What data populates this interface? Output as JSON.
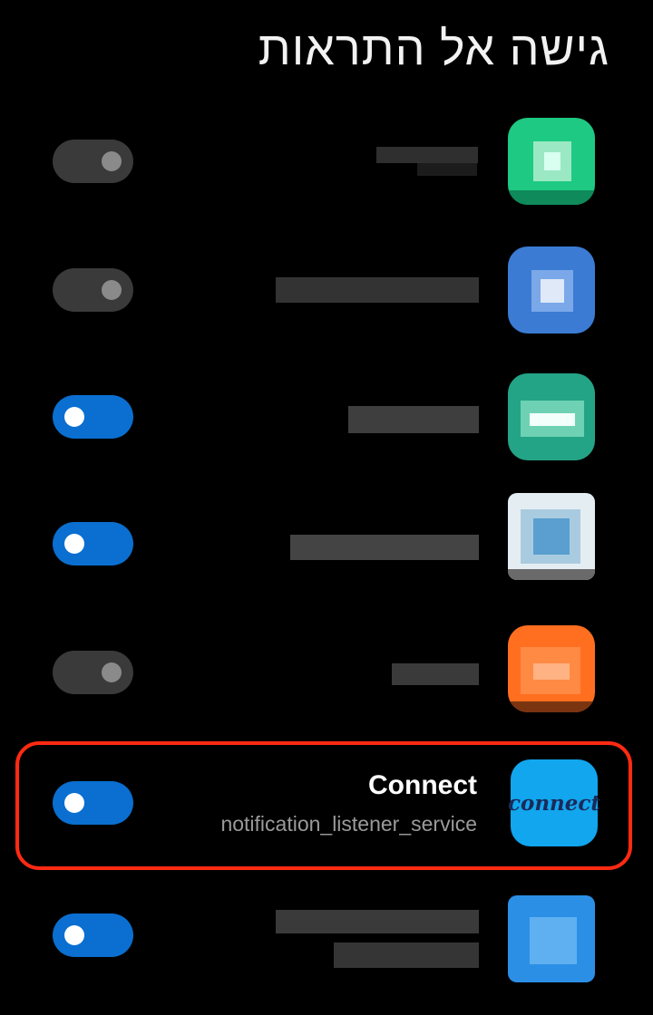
{
  "header": {
    "title": "גישה אל התראות"
  },
  "apps": [
    {
      "name": "",
      "enabled": false,
      "icon_color": "#1ec983"
    },
    {
      "name": "",
      "enabled": false,
      "icon_color": "#3b7bd4"
    },
    {
      "name": "",
      "enabled": true,
      "icon_color": "#23a486"
    },
    {
      "name": "",
      "enabled": true,
      "icon_color": "#e4eef2"
    },
    {
      "name": "",
      "enabled": false,
      "icon_color": "#ff6f1f"
    },
    {
      "name": "Connect",
      "subtitle": "notification_listener_service",
      "enabled": true,
      "icon_label": "connect",
      "icon_color": "#11a6ee"
    },
    {
      "name": "",
      "enabled": true,
      "icon_color": "#2c8fe6"
    }
  ],
  "colors": {
    "toggle_on": "#0a6fd0",
    "toggle_off": "#3a3a3a",
    "highlight": "#ff2a12"
  }
}
